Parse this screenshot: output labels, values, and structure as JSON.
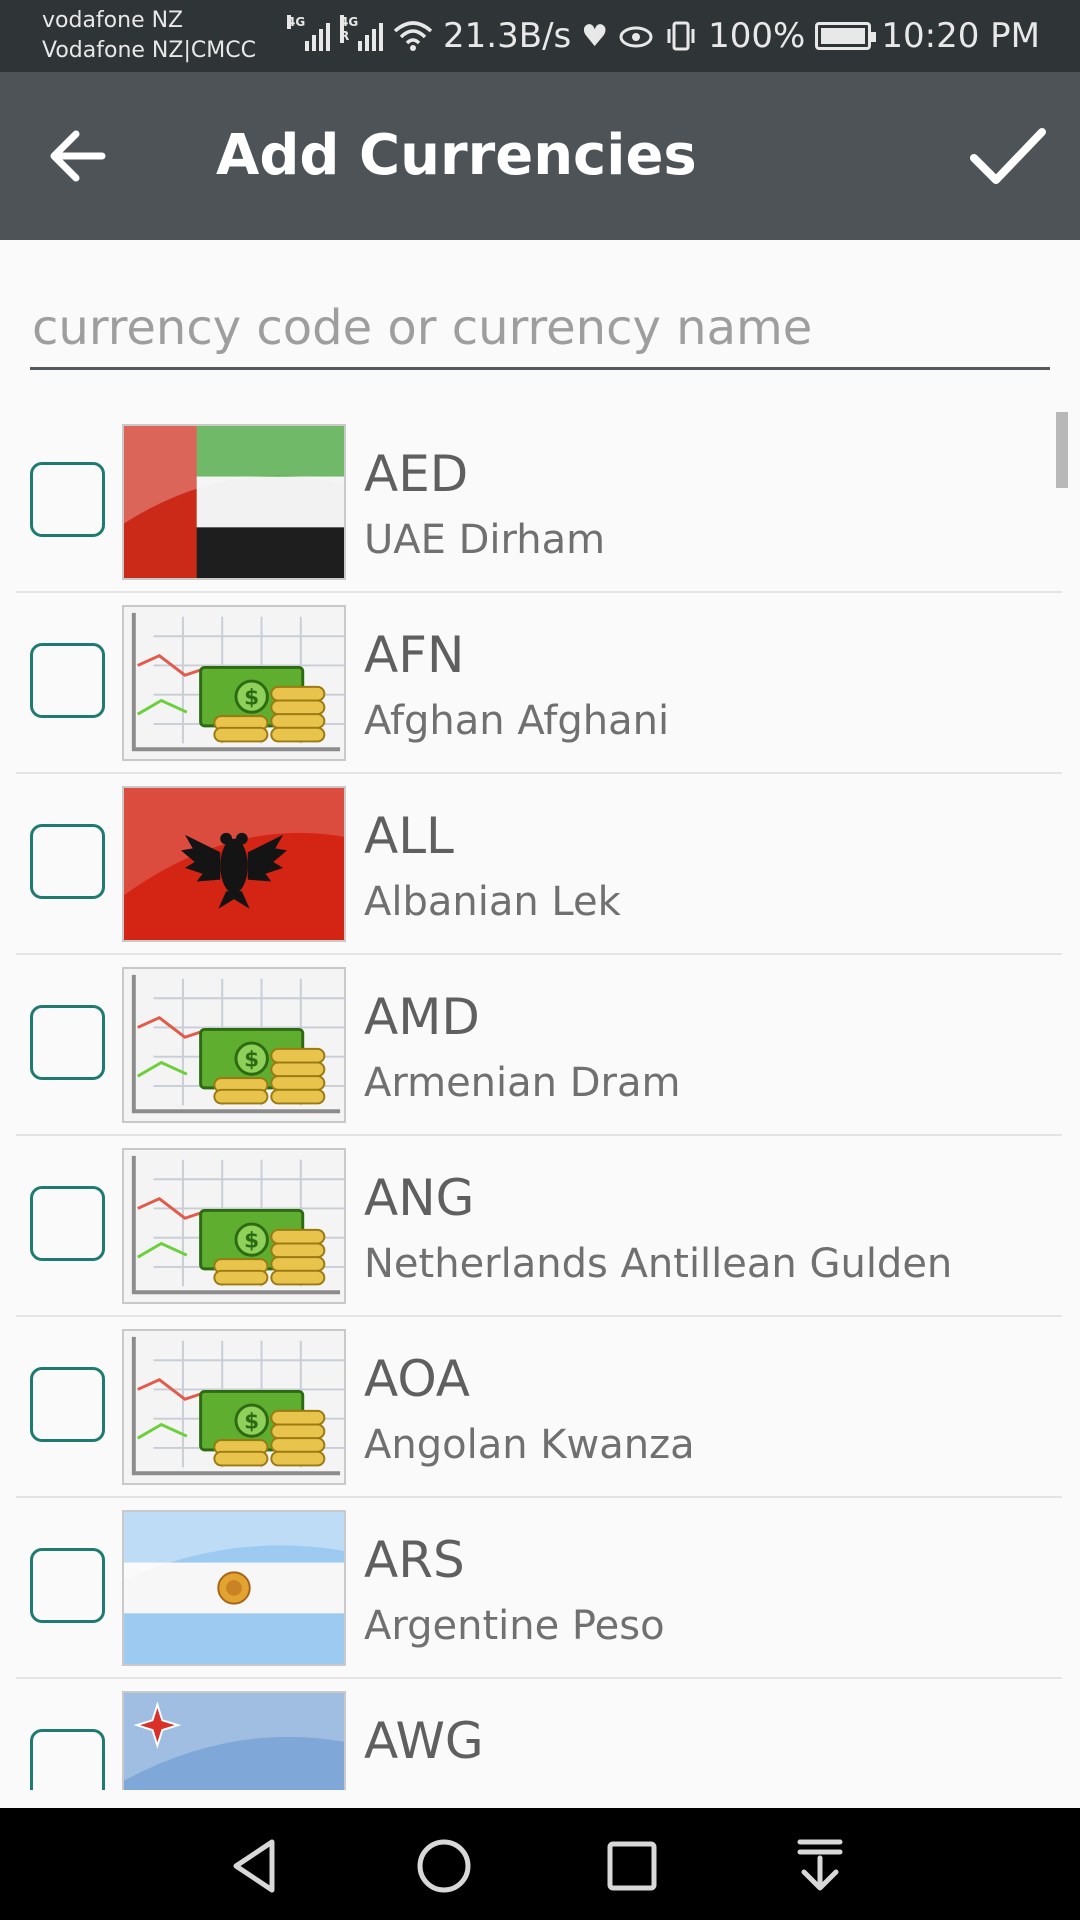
{
  "status_bar": {
    "carrier_line1": "vodafone NZ",
    "carrier_line2": "Vodafone NZ|CMCC",
    "network_label_1": "4G",
    "network_label_2": "4G R",
    "speed": "21.3B/s",
    "battery": "100%",
    "time": "10:20 PM"
  },
  "toolbar": {
    "title": "Add Currencies",
    "back_icon": "arrow-left-icon",
    "confirm_icon": "checkmark-icon",
    "background": "#4d5357"
  },
  "search": {
    "placeholder": "currency code or currency name",
    "value": ""
  },
  "currencies": [
    {
      "code": "AED",
      "name": "UAE Dirham",
      "checked": false,
      "icon": "uae-flag"
    },
    {
      "code": "AFN",
      "name": "Afghan Afghani",
      "checked": false,
      "icon": "generic-currency"
    },
    {
      "code": "ALL",
      "name": "Albanian Lek",
      "checked": false,
      "icon": "albania-flag"
    },
    {
      "code": "AMD",
      "name": "Armenian Dram",
      "checked": false,
      "icon": "generic-currency"
    },
    {
      "code": "ANG",
      "name": "Netherlands Antillean Gulden",
      "checked": false,
      "icon": "generic-currency"
    },
    {
      "code": "AOA",
      "name": "Angolan Kwanza",
      "checked": false,
      "icon": "generic-currency"
    },
    {
      "code": "ARS",
      "name": "Argentine Peso",
      "checked": false,
      "icon": "argentina-flag"
    },
    {
      "code": "AWG",
      "name": "",
      "checked": false,
      "icon": "aruba-flag"
    }
  ],
  "colors": {
    "checkbox_border": "#1f7a72",
    "status_bar": "#2f3437"
  },
  "nav_bar": {
    "buttons": [
      "back-triangle-icon",
      "home-circle-icon",
      "recents-square-icon",
      "notification-pulldown-icon"
    ]
  }
}
